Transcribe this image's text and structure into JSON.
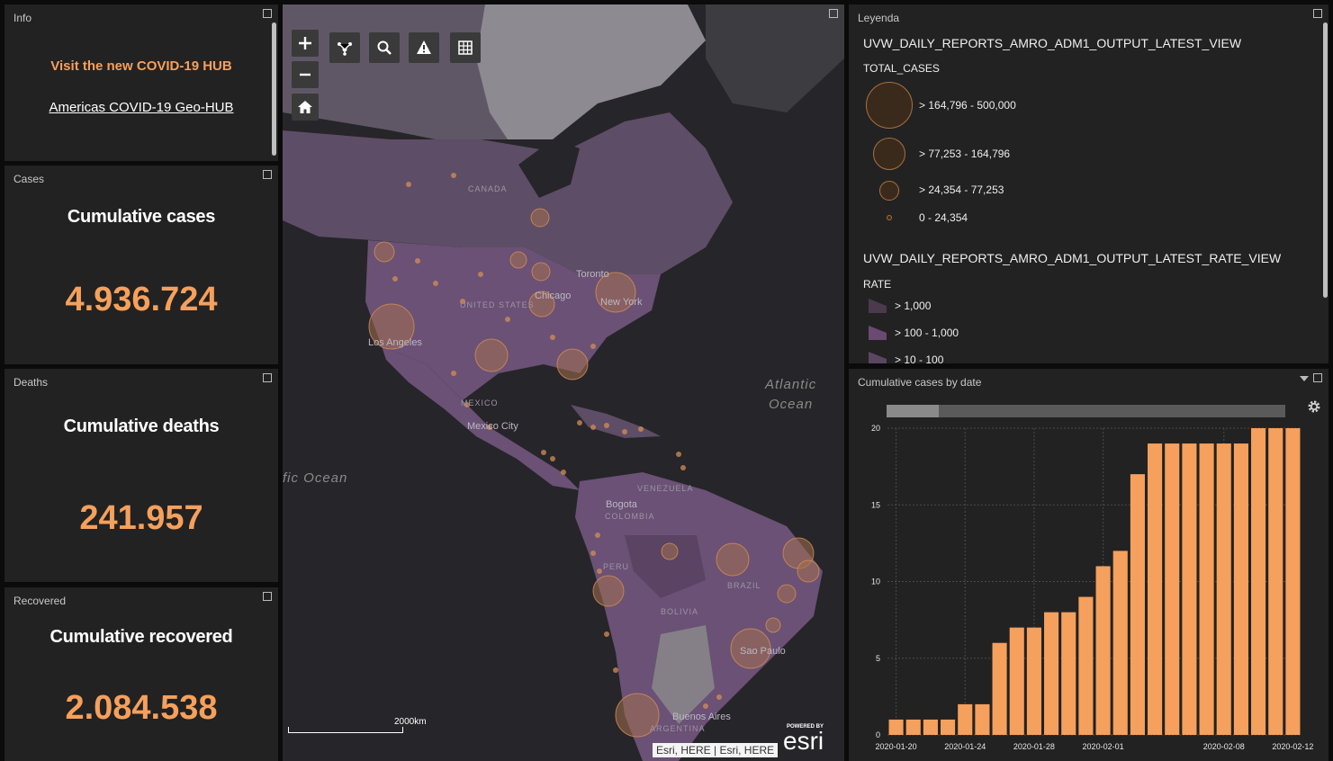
{
  "info": {
    "title": "Info",
    "hub_link": "Visit the new COVID-19 HUB",
    "geo_link": "Americas COVID-19 Geo-HUB"
  },
  "cases": {
    "title": "Cases",
    "heading": "Cumulative cases",
    "value": "4.936.724"
  },
  "deaths": {
    "title": "Deaths",
    "heading": "Cumulative deaths",
    "value": "241.957"
  },
  "recovered": {
    "title": "Recovered",
    "heading": "Cumulative recovered",
    "value": "2.084.538"
  },
  "map": {
    "toolbar": [
      "zoom-in",
      "zoom-out",
      "home",
      "basemap",
      "search",
      "alert",
      "grid"
    ],
    "labels": {
      "canada": "CANADA",
      "united_states": "UNITED STATES",
      "mexico": "MEXICO",
      "venezuela": "VENEZUELA",
      "colombia": "COLOMBIA",
      "peru": "PERU",
      "brazil": "BRAZIL",
      "bolivia": "BOLIVIA",
      "argentina": "ARGENTINA",
      "toronto": "Toronto",
      "chicago": "Chicago",
      "new_york": "New York",
      "los_angeles": "Los Angeles",
      "mexico_city": "Mexico City",
      "bogota": "Bogota",
      "sao_paulo": "Sao Paulo",
      "buenos_aires": "Buenos Aires",
      "atlantic_1": "Atlantic",
      "atlantic_2": "Ocean",
      "pacific": "fic Ocean"
    },
    "scale": "2000km",
    "attribution": "Esri, HERE | Esri, HERE",
    "powered_by": "POWERED BY",
    "esri": "esri"
  },
  "legend": {
    "title": "Leyenda",
    "layer1": "UVW_DAILY_REPORTS_AMRO_ADM1_OUTPUT_LATEST_VIEW",
    "field1": "TOTAL_CASES",
    "classes1": [
      "> 164,796 - 500,000",
      "> 77,253 - 164,796",
      "> 24,354 - 77,253",
      "0 - 24,354"
    ],
    "layer2": "UVW_DAILY_REPORTS_AMRO_ADM1_OUTPUT_LATEST_RATE_VIEW",
    "field2": "RATE",
    "classes2": [
      "> 1,000",
      "> 100 - 1,000",
      "> 10 - 100"
    ]
  },
  "chart_panel": {
    "title": "Cumulative cases by date"
  },
  "chart_data": {
    "type": "bar",
    "categories": [
      "2020-01-20",
      "2020-01-21",
      "2020-01-22",
      "2020-01-23",
      "2020-01-24",
      "2020-01-25",
      "2020-01-26",
      "2020-01-27",
      "2020-01-28",
      "2020-01-29",
      "2020-01-30",
      "2020-01-31",
      "2020-02-01",
      "2020-02-02",
      "2020-02-03",
      "2020-02-04",
      "2020-02-05",
      "2020-02-06",
      "2020-02-07",
      "2020-02-08",
      "2020-02-09",
      "2020-02-10",
      "2020-02-11",
      "2020-02-12"
    ],
    "values": [
      1,
      1,
      1,
      1,
      2,
      2,
      6,
      7,
      7,
      8,
      8,
      9,
      11,
      12,
      17,
      19,
      19,
      19,
      19,
      19,
      19,
      20,
      20,
      20
    ],
    "x_tick_labels": [
      "2020-01-20",
      "2020-01-24",
      "2020-01-28",
      "2020-02-01",
      "2020-02-08",
      "2020-02-12"
    ],
    "y_ticks": [
      "0",
      "5",
      "10",
      "15",
      "20"
    ],
    "ylim": [
      0,
      20
    ],
    "color": "#f5a05c",
    "grid": true
  }
}
